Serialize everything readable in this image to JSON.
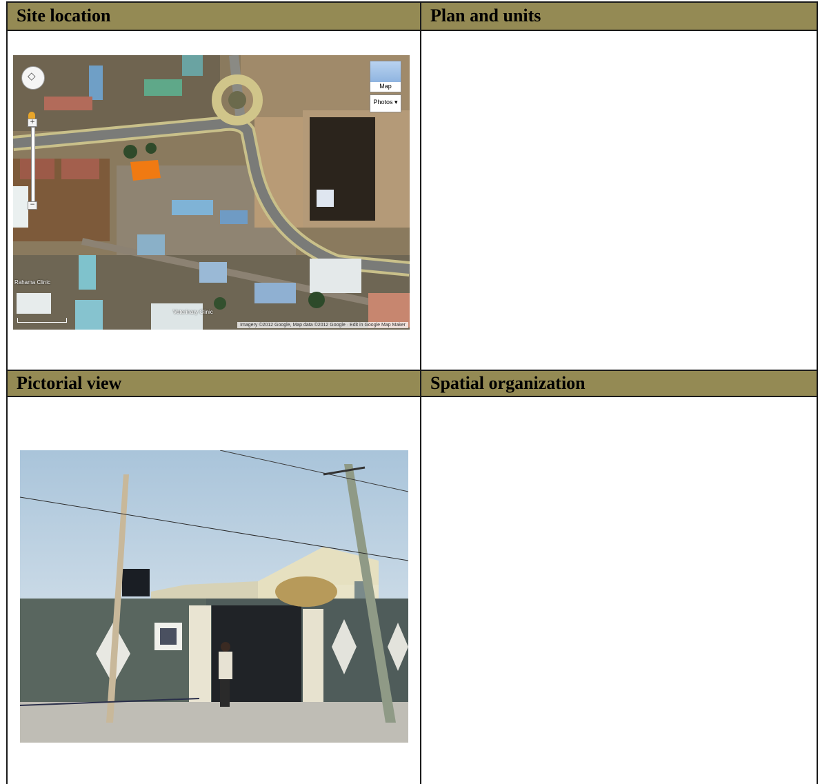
{
  "table": {
    "headers": {
      "site_location": "Site location",
      "plan_and_units": "Plan and units",
      "pictorial_view": "Pictorial view",
      "spatial_organization": "Spatial organization"
    }
  },
  "map": {
    "map_button_label": "Map",
    "photos_button_label": "Photos",
    "photos_button_caret": "▾",
    "attribution": "Imagery ©2012 Google, Map data ©2012 Google · Edit in Google Map Maker",
    "label_left": "Rahama Clinic",
    "label_bottom": "Veterinary Clinic"
  },
  "colors": {
    "header_bg": "#948a54",
    "border": "#1a1a1a",
    "highlight_parcel": "#f07a12"
  }
}
